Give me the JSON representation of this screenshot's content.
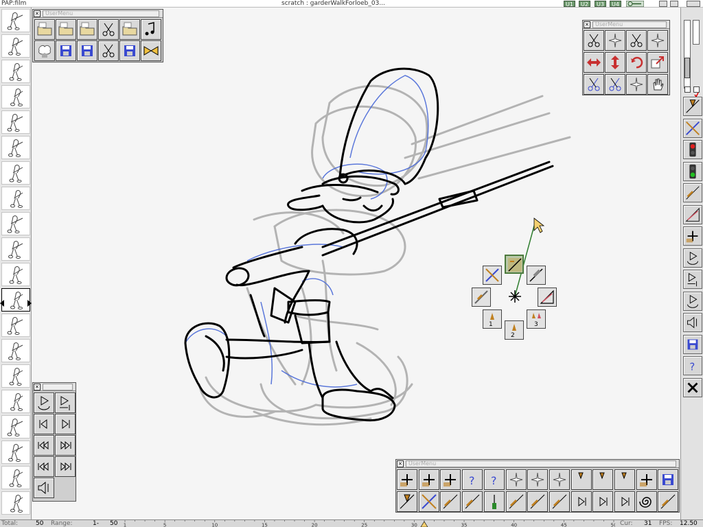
{
  "window": {
    "app_title": "PAP:film",
    "document_title": "scratch : garderWalkForloeb_03...",
    "user_buttons": [
      "U1",
      "U2",
      "U3",
      "U4"
    ]
  },
  "palettes": {
    "top_left": {
      "title": "UserMenu",
      "close": "×"
    },
    "top_right": {
      "title": "UserMenu",
      "close": "×"
    },
    "bottom_left": {
      "title": "",
      "close": "×"
    },
    "bottom_right": {
      "title": "UserMenu",
      "close": "×"
    }
  },
  "pie_menu": {
    "labels": [
      "1",
      "2",
      "3"
    ]
  },
  "status": {
    "total_label": "Total:",
    "total_value": "50",
    "range_label": "Range:",
    "range_start": "1-",
    "range_end": "50",
    "ticks": [
      "1",
      "5",
      "10",
      "15",
      "20",
      "25",
      "30",
      "35",
      "40",
      "45",
      "50"
    ],
    "cur_label": "Cur:",
    "cur_value": "31",
    "fps_label": "FPS:",
    "fps_value": "12.50"
  },
  "frames": {
    "count": 20,
    "current_index": 11
  },
  "colors": {
    "accent_green": "#4c7a3c",
    "sketch_blue": "#4a6ad8",
    "ink": "#000000",
    "onion_grey": "#9a9a9a"
  },
  "icons": {
    "right_toolbar": [
      "pencil-brush-icon",
      "cross-out-icon",
      "red-light-icon",
      "green-light-icon",
      "draw-tool-icon",
      "eraser-icon",
      "add-brush-icon",
      "loop-play-icon",
      "play-to-end-icon",
      "loop-back-icon",
      "mute-icon",
      "save-icon",
      "help-icon",
      "close-icon"
    ]
  }
}
